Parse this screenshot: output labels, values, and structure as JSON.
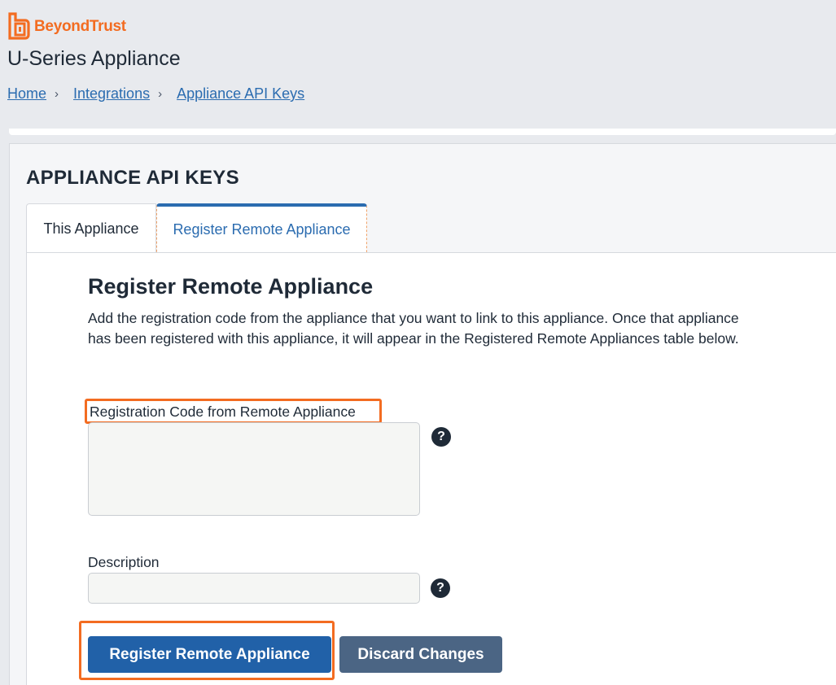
{
  "brand": {
    "name": "BeyondTrust",
    "accent": "#f36c21"
  },
  "app": {
    "title": "U-Series Appliance"
  },
  "breadcrumb": [
    {
      "label": "Home"
    },
    {
      "label": "Integrations"
    },
    {
      "label": "Appliance API Keys"
    }
  ],
  "page": {
    "title": "APPLIANCE API KEYS"
  },
  "tabs": [
    {
      "label": "This Appliance",
      "active": false
    },
    {
      "label": "Register Remote Appliance",
      "active": true
    }
  ],
  "form": {
    "title": "Register Remote Appliance",
    "description": "Add the registration code from the appliance that you want to link to this appliance. Once that appliance has been registered with this appliance, it will appear in the Registered Remote Appliances table below.",
    "registration_code": {
      "label": "Registration Code from Remote Appliance",
      "value": ""
    },
    "description_field": {
      "label": "Description",
      "value": ""
    },
    "help_icon": "?",
    "buttons": {
      "register": "Register Remote Appliance",
      "discard": "Discard Changes"
    }
  },
  "colors": {
    "primary_button": "#2161a8",
    "secondary_button": "#4b6584",
    "link": "#2b6cb0",
    "highlight": "#f36c21"
  }
}
